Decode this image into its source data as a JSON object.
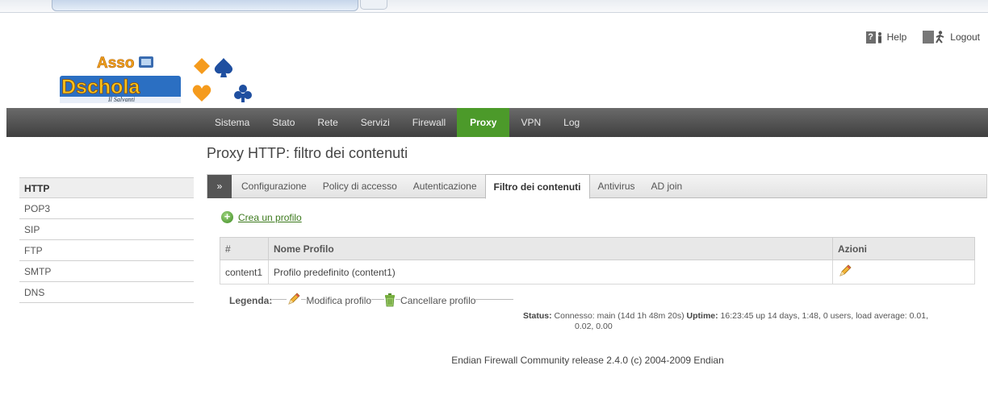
{
  "header": {
    "help_label": "Help",
    "logout_label": "Logout",
    "help_icon": "help-icon",
    "logout_icon": "logout-icon",
    "logo": {
      "line1": "Asso",
      "line2": "Dschola",
      "tagline": "Il Salvanti"
    }
  },
  "nav": {
    "items": [
      "Sistema",
      "Stato",
      "Rete",
      "Servizi",
      "Firewall",
      "Proxy",
      "VPN",
      "Log"
    ],
    "active": "Proxy",
    "active_color": "#4c9a2a"
  },
  "page": {
    "title": "Proxy HTTP: filtro dei contenuti"
  },
  "sidebar": {
    "items": [
      "HTTP",
      "POP3",
      "SIP",
      "FTP",
      "SMTP",
      "DNS"
    ],
    "active": "HTTP"
  },
  "tabs": {
    "arrow": "»",
    "items": [
      "Configurazione",
      "Policy di accesso",
      "Autenticazione",
      "Filtro dei contenuti",
      "Antivirus",
      "AD join"
    ],
    "active": "Filtro dei contenuti"
  },
  "create_profile": {
    "label": "Crea un profilo"
  },
  "table": {
    "headers": [
      "#",
      "Nome Profilo",
      "Azioni"
    ],
    "rows": [
      {
        "id": "content1",
        "name": "Profilo predefinito (content1)"
      }
    ]
  },
  "legend": {
    "title": "Legenda:",
    "edit_label": "Modifica profilo",
    "delete_label": "Cancellare profilo"
  },
  "status": {
    "status_label": "Status:",
    "status_value": "Connesso: main (14d 1h 48m 20s)",
    "uptime_label": "Uptime:",
    "uptime_value_1": "16:23:45 up 14 days, 1:48, 0 users, load average: 0.01,",
    "uptime_value_2": "0.02, 0.00"
  },
  "footer": {
    "text": "Endian Firewall Community release 2.4.0 (c) 2004-2009 Endian"
  }
}
